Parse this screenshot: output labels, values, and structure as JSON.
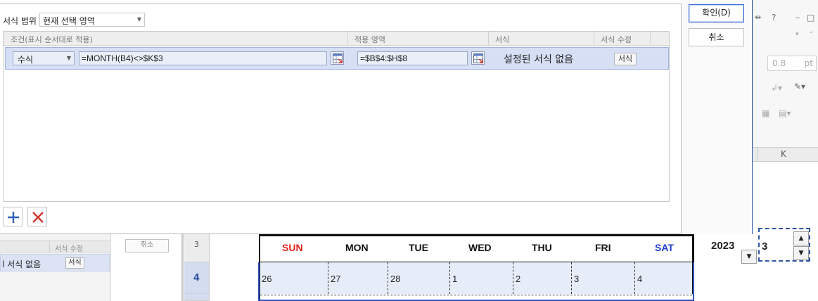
{
  "dialog": {
    "scope_label": "서식 범위",
    "scope_value": "현재 선택 영역",
    "columns": {
      "condition": "조건(표시 순서대로 적용)",
      "range": "적용 영역",
      "format": "서식",
      "edit_format": "서식 수정"
    },
    "rule": {
      "type": "수식",
      "formula": "=MONTH(B4)<>$K$3",
      "range": "=$B$4:$H$8",
      "format_preview": "설정된 서식 없음",
      "format_button": "서식"
    },
    "ok_label": "확인(D)",
    "cancel_label": "취소"
  },
  "background": {
    "left_panel_header": "서식 수정",
    "left_panel_row_text": "l 서식 없음",
    "left_panel_row_button": "서식",
    "small_cancel": "취소",
    "row_numbers": [
      "3",
      "4"
    ],
    "days": [
      {
        "label": "SUN",
        "color": "#e0201b"
      },
      {
        "label": "MON",
        "color": "#111111"
      },
      {
        "label": "TUE",
        "color": "#111111"
      },
      {
        "label": "WED",
        "color": "#111111"
      },
      {
        "label": "THU",
        "color": "#111111"
      },
      {
        "label": "FRI",
        "color": "#111111"
      },
      {
        "label": "SAT",
        "color": "#1f3fd0"
      }
    ],
    "dates": [
      "26",
      "27",
      "28",
      "1",
      "2",
      "3",
      "4"
    ],
    "year": "2023",
    "month": "3",
    "column_k": "K",
    "toolbar_question": "?",
    "toolbar_size_value": "0.8",
    "toolbar_size_unit": "pt"
  },
  "colors": {
    "accent": "#2f55a4",
    "selected_row": "#d6dff4",
    "delete_red": "#d0342c",
    "add_blue": "#2f5fb8"
  }
}
